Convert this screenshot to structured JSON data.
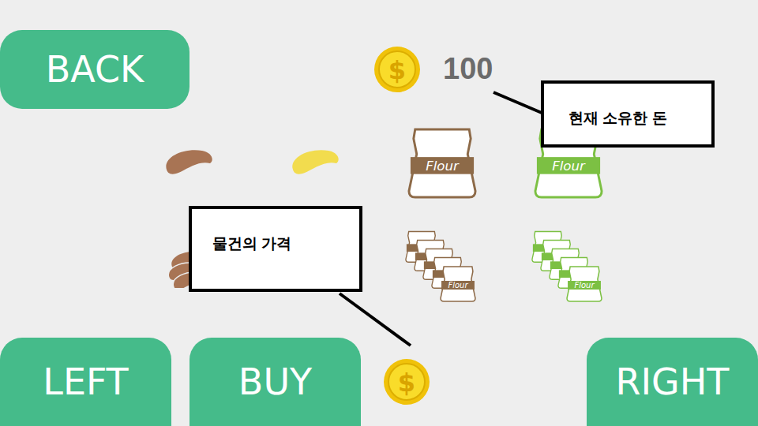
{
  "back_button": "BACK",
  "wallet": {
    "symbol": "$",
    "amount": "100"
  },
  "annotations": {
    "wallet_note": "현재 소유한 돈",
    "price_note": "물건의 가격"
  },
  "items": [
    {
      "kind": "bean",
      "color": "#a87454"
    },
    {
      "kind": "bean",
      "color": "#f2dc4e"
    },
    {
      "kind": "bag",
      "color": "#8d6a48",
      "label": "Flour"
    },
    {
      "kind": "bag",
      "color": "#7cc043",
      "label": "Flour"
    },
    {
      "kind": "pile",
      "color": "#a87454"
    },
    {
      "kind": "stack",
      "color": "#8d6a48",
      "label": "Flour"
    },
    {
      "kind": "stack",
      "color": "#7cc043",
      "label": "Flour"
    }
  ],
  "price": {
    "symbol": "$"
  },
  "buttons": {
    "left": "LEFT",
    "buy": "BUY",
    "right": "RIGHT"
  }
}
